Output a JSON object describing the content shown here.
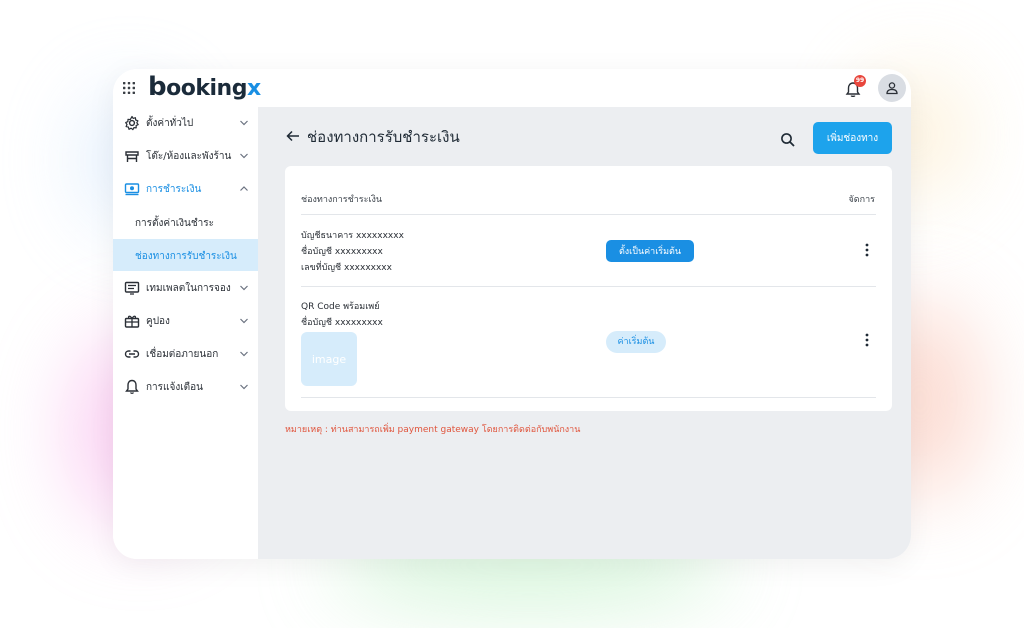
{
  "app": {
    "logo_main": "ooking",
    "logo_b": "b",
    "logo_x": "x",
    "notification_count": "99",
    "brand_color": "#1a8fe3"
  },
  "sidebar": {
    "items": [
      {
        "label": "ตั้งค่าทั่วไป",
        "icon": "gear-icon",
        "expanded": false
      },
      {
        "label": "โต๊ะ/ห้องและพังร้าน",
        "icon": "table-icon",
        "expanded": false
      },
      {
        "label": "การชำระเงิน",
        "icon": "payment-icon",
        "expanded": true
      },
      {
        "label": "เทมเพลตในการจอง",
        "icon": "template-icon",
        "expanded": false
      },
      {
        "label": "คูปอง",
        "icon": "coupon-icon",
        "expanded": false
      },
      {
        "label": "เชื่อมต่อภายนอก",
        "icon": "link-icon",
        "expanded": false
      },
      {
        "label": "การแจ้งเตือน",
        "icon": "bell-icon",
        "expanded": false
      }
    ],
    "sub_items": [
      {
        "label": "การตั้งค่าเงินชำระ",
        "selected": false
      },
      {
        "label": "ช่องทางการรับชำระเงิน",
        "selected": true
      }
    ]
  },
  "main": {
    "title": "ช่องทางการรับชำระเงิน",
    "add_button": "เพิ่มช่องทาง",
    "table": {
      "col_channel": "ช่องทางการชำระเงิน",
      "col_manage": "จัดการ",
      "rows": [
        {
          "lines": [
            "บัญชีธนาคาร xxxxxxxxx",
            "ชื่อบัญชี xxxxxxxxx",
            "เลขที่บัญชี xxxxxxxxx"
          ],
          "action": "ตั้งเป็นค่าเริ่มต้น"
        },
        {
          "lines": [
            "QR Code พร้อมเพย์",
            "ชื่อบัญชี xxxxxxxxx"
          ],
          "image_label": "image",
          "badge": "ค่าเริ่มต้น"
        }
      ]
    },
    "note": "หมายเหตุ : ท่านสามารถเพิ่ม payment gateway โดยการติดต่อกับพนักงาน"
  }
}
